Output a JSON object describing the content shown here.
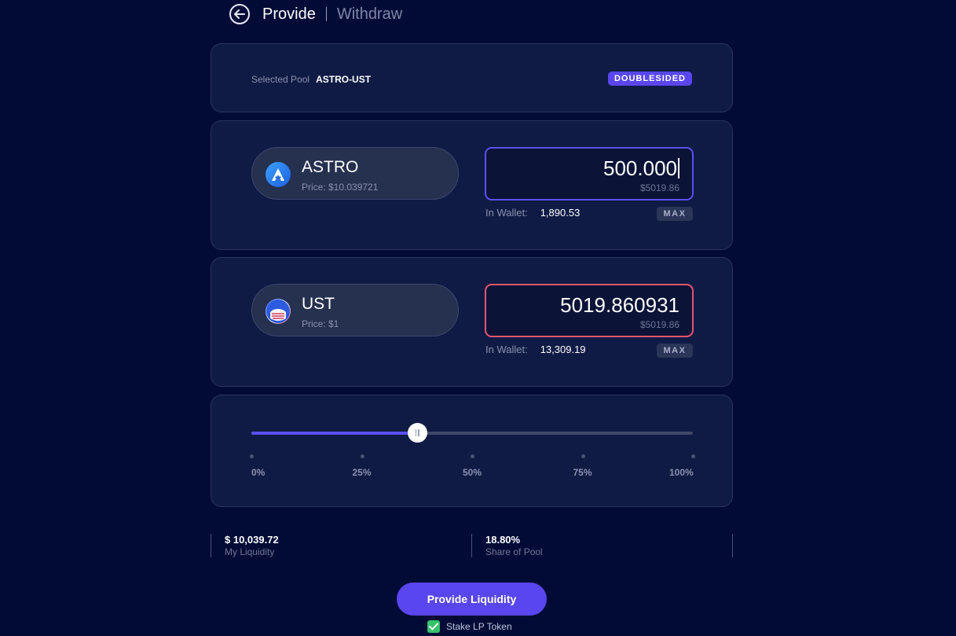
{
  "header": {
    "provide_label": "Provide",
    "withdraw_label": "Withdraw"
  },
  "pool": {
    "label": "Selected Pool",
    "name": "ASTRO-UST",
    "badge": "DOUBLESIDED"
  },
  "tokens": [
    {
      "symbol": "ASTRO",
      "price": "Price: $10.039721",
      "amount": "500.000",
      "amount_usd": "$5019.86",
      "wallet_label": "In Wallet:",
      "wallet_value": "1,890.53",
      "max_label": "MAX",
      "icon": "astro-logo-icon",
      "state": "focused"
    },
    {
      "symbol": "UST",
      "price": "Price: $1",
      "amount": "5019.860931",
      "amount_usd": "$5019.86",
      "wallet_label": "In Wallet:",
      "wallet_value": "13,309.19",
      "max_label": "MAX",
      "icon": "ust-logo-icon",
      "state": "error"
    }
  ],
  "slider": {
    "value_percent": 37.5,
    "ticks": [
      "0%",
      "25%",
      "50%",
      "75%",
      "100%"
    ]
  },
  "stats": {
    "my_liquidity_value": "$ 10,039.72",
    "my_liquidity_label": "My Liquidity",
    "share_value": "18.80%",
    "share_label": "Share of Pool"
  },
  "actions": {
    "provide_button": "Provide Liquidity",
    "stake_label": "Stake LP Token",
    "stake_checked": true
  },
  "colors": {
    "background": "#020b36",
    "accent": "#5a46f0",
    "error": "#e0566e",
    "success": "#34c36a"
  }
}
